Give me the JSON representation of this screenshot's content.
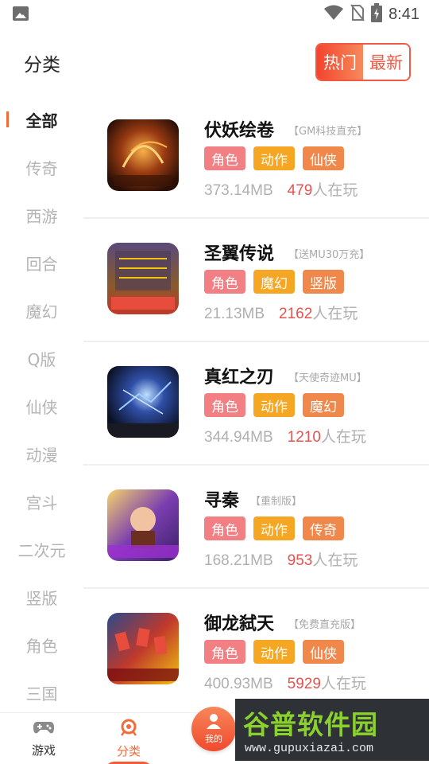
{
  "status_bar": {
    "time": "8:41",
    "icons": [
      "gallery-icon",
      "wifi-icon",
      "no-sim-icon",
      "battery-charging-icon"
    ]
  },
  "header": {
    "title": "分类",
    "toggle": {
      "hot": "热门",
      "newest": "最新",
      "selected": "hot"
    }
  },
  "sidebar": {
    "items": [
      {
        "label": "全部",
        "active": true
      },
      {
        "label": "传奇",
        "active": false
      },
      {
        "label": "西游",
        "active": false
      },
      {
        "label": "回合",
        "active": false
      },
      {
        "label": "魔幻",
        "active": false
      },
      {
        "label": "Q版",
        "active": false
      },
      {
        "label": "仙侠",
        "active": false
      },
      {
        "label": "动漫",
        "active": false
      },
      {
        "label": "宫斗",
        "active": false
      },
      {
        "label": "二次元",
        "active": false
      },
      {
        "label": "竖版",
        "active": false
      },
      {
        "label": "角色",
        "active": false
      },
      {
        "label": "三国",
        "active": false
      }
    ]
  },
  "games": [
    {
      "title": "伏妖绘卷",
      "promo": "【GM科技直充】",
      "tags": [
        "角色",
        "动作",
        "仙侠"
      ],
      "size": "373.14MB",
      "players": "479",
      "players_suffix": "人在玩"
    },
    {
      "title": "圣翼传说",
      "promo": "【送MU30万充】",
      "tags": [
        "角色",
        "魔幻",
        "竖版"
      ],
      "size": "21.13MB",
      "players": "2162",
      "players_suffix": "人在玩"
    },
    {
      "title": "真红之刃",
      "promo": "【天使奇迹MU】",
      "tags": [
        "角色",
        "动作",
        "魔幻"
      ],
      "size": "344.94MB",
      "players": "1210",
      "players_suffix": "人在玩"
    },
    {
      "title": "寻秦",
      "promo": "【重制版】",
      "tags": [
        "角色",
        "动作",
        "传奇"
      ],
      "size": "168.21MB",
      "players": "953",
      "players_suffix": "人在玩"
    },
    {
      "title": "御龙弑天",
      "promo": "【免费直充版】",
      "tags": [
        "角色",
        "动作",
        "仙侠"
      ],
      "size": "400.93MB",
      "players": "5929",
      "players_suffix": "人在玩"
    }
  ],
  "bottom_nav": {
    "games": "游戏",
    "category": "分类",
    "mine": "我的"
  },
  "watermark": {
    "title": "谷普软件园",
    "url": "www.gupuxiazai.com"
  },
  "colors": {
    "accent": "#f26b3a",
    "count_red": "#e5524f",
    "tag_pink": "#f27f84",
    "tag_yellow": "#f5a623",
    "tag_orange": "#f0884c"
  }
}
